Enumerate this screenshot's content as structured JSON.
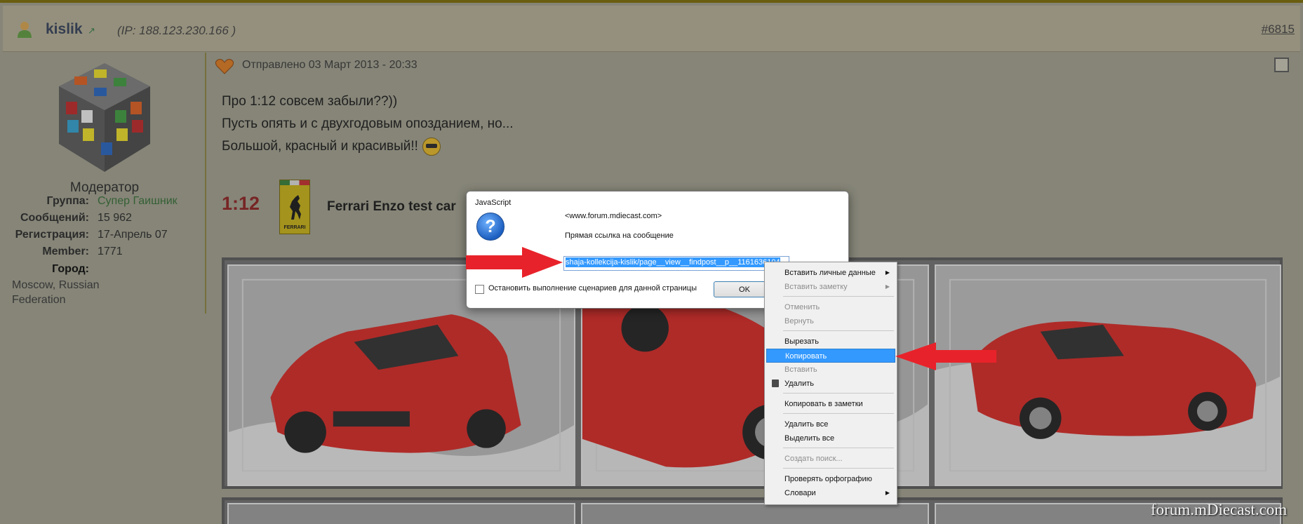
{
  "header": {
    "username": "kislik",
    "ip": "(IP: 188.123.230.166 )",
    "post_number": "#6815"
  },
  "sidebar": {
    "role": "Модератор",
    "group_label": "Группа:",
    "group_value": "Супер Гаишник",
    "messages_label": "Сообщений:",
    "messages_value": "15 962",
    "registration_label": "Регистрация:",
    "registration_value": "17-Апрель 07",
    "member_label": "Member:",
    "member_value": "1771",
    "city_label": "Город:",
    "city_value": "Moscow, Russian Federation"
  },
  "post": {
    "meta": "Отправлено 03 Март 2013 - 20:33",
    "lines": [
      "Про 1:12 совсем забыли??))",
      "Пусть опять и с двухгодовым опозданием, но...",
      "Большой, красный и красивый!!"
    ],
    "scale": "1:12",
    "badge_text": "FERRARI",
    "car_title": "Ferrari Enzo test car"
  },
  "dialog": {
    "title": "JavaScript",
    "origin": "<www.forum.mdiecast.com>",
    "message": "Прямая ссылка на сообщение",
    "input_value": "shaja-kollekcija-kislik/page__view__findpost__p__1161636104",
    "checkbox_label": "Остановить выполнение сценариев для данной страницы",
    "ok_label": "OK"
  },
  "context_menu": {
    "items": [
      {
        "label": "Вставить личные данные",
        "disabled": false,
        "submenu": true
      },
      {
        "label": "Вставить заметку",
        "disabled": true,
        "submenu": true
      },
      {
        "label": "Отменить",
        "disabled": true
      },
      {
        "label": "Вернуть",
        "disabled": true
      },
      {
        "label": "Вырезать",
        "disabled": false
      },
      {
        "label": "Копировать",
        "disabled": false,
        "highlighted": true
      },
      {
        "label": "Вставить",
        "disabled": true
      },
      {
        "label": "Удалить",
        "disabled": false
      },
      {
        "label": "Копировать в заметки",
        "disabled": false
      },
      {
        "label": "Удалить все",
        "disabled": false
      },
      {
        "label": "Выделить все",
        "disabled": false
      },
      {
        "label": "Создать поиск...",
        "disabled": true
      },
      {
        "label": "Проверять орфографию",
        "disabled": false
      },
      {
        "label": "Словари",
        "disabled": false,
        "submenu": true
      }
    ]
  },
  "watermark": "forum.mDiecast.com",
  "colors": {
    "highlight": "#3399ff",
    "annotation_arrow": "#e8222a",
    "scale_text": "#8b1a1a"
  }
}
